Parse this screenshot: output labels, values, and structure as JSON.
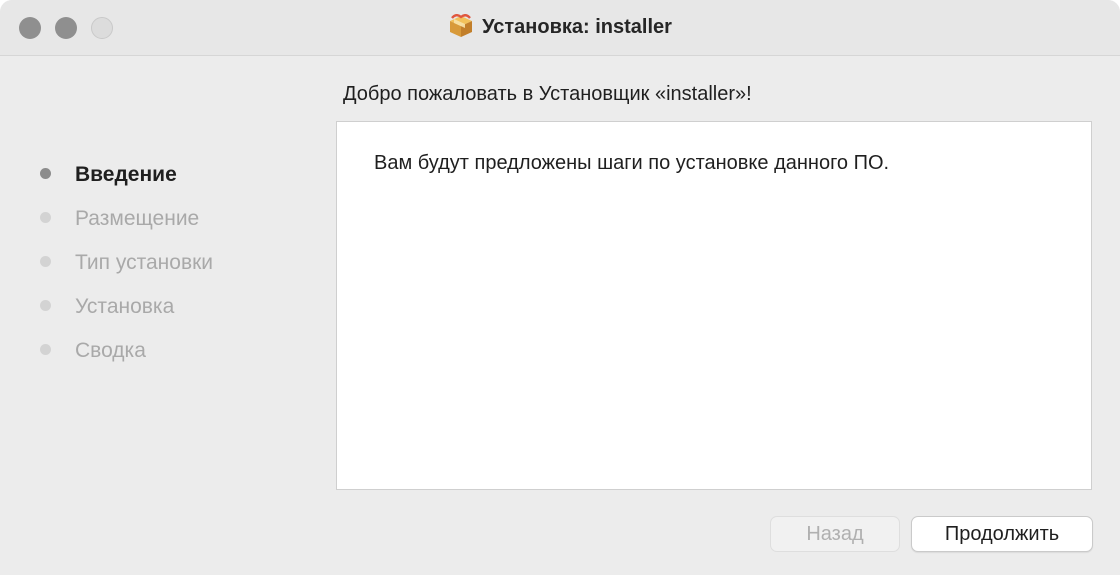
{
  "window": {
    "title": "Установка: installer",
    "title_icon": "package-icon",
    "traffic_lights": [
      "close",
      "minimize",
      "zoom"
    ]
  },
  "heading": "Добро пожаловать в Установщик «installer»!",
  "steps": [
    {
      "label": "Введение",
      "active": true
    },
    {
      "label": "Размещение",
      "active": false
    },
    {
      "label": "Тип установки",
      "active": false
    },
    {
      "label": "Установка",
      "active": false
    },
    {
      "label": "Сводка",
      "active": false
    }
  ],
  "content": {
    "text": "Вам будут предложены шаги по установке данного ПО."
  },
  "buttons": {
    "back": {
      "label": "Назад",
      "enabled": false
    },
    "continue": {
      "label": "Продолжить",
      "enabled": true
    }
  }
}
